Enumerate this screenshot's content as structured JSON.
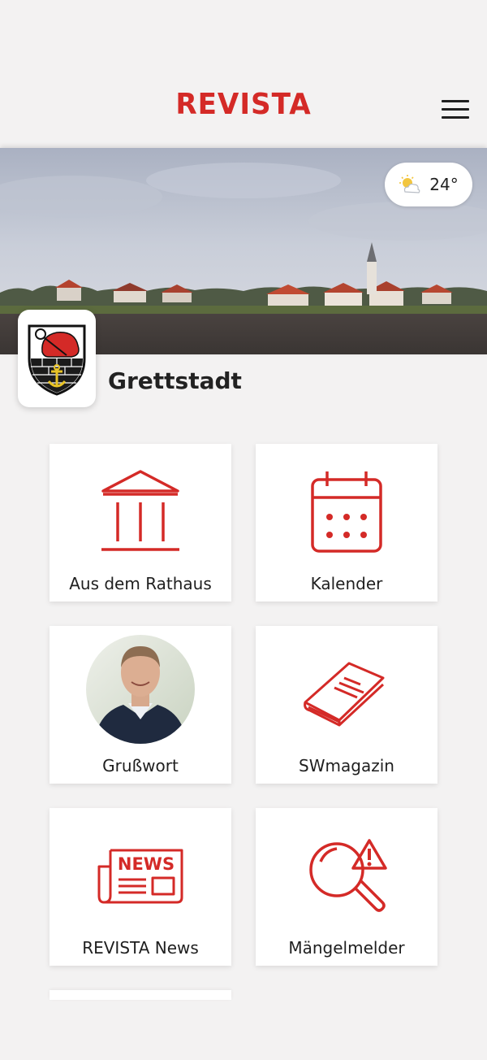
{
  "app": {
    "brand": "REVISTA"
  },
  "weather": {
    "temperature": "24°",
    "icon": "partly-sunny-icon"
  },
  "town": {
    "name": "Grettstadt"
  },
  "tiles": [
    {
      "label": "Aus dem Rathaus",
      "icon": "town-hall-icon"
    },
    {
      "label": "Kalender",
      "icon": "calendar-icon"
    },
    {
      "label": "Grußwort",
      "icon": "mayor-portrait"
    },
    {
      "label": "SWmagazin",
      "icon": "magazine-icon"
    },
    {
      "label": "REVISTA News",
      "icon": "newspaper-icon"
    },
    {
      "label": "Mängelmelder",
      "icon": "search-warning-icon"
    }
  ],
  "colors": {
    "accent": "#d42a27",
    "background": "#f3f2f2"
  }
}
